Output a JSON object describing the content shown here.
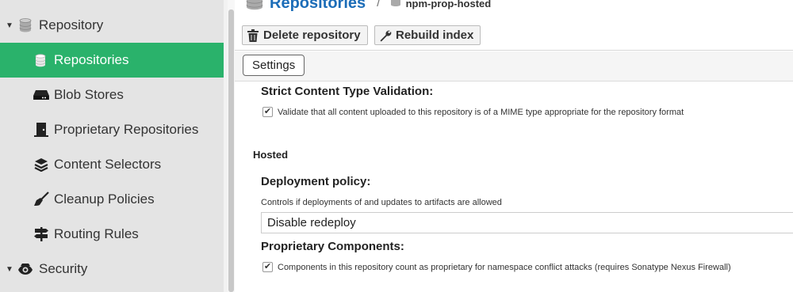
{
  "sidebar": {
    "repository_group": "Repository",
    "items": [
      {
        "label": "Repositories",
        "icon": "database-icon"
      },
      {
        "label": "Blob Stores",
        "icon": "hard-drive-icon"
      },
      {
        "label": "Proprietary Repositories",
        "icon": "door-icon"
      },
      {
        "label": "Content Selectors",
        "icon": "layers-icon"
      },
      {
        "label": "Cleanup Policies",
        "icon": "broom-icon"
      },
      {
        "label": "Routing Rules",
        "icon": "signpost-icon"
      }
    ],
    "security_group": "Security",
    "selected_color": "#2ab26b"
  },
  "header": {
    "title": "Repositories",
    "separator": "/",
    "current": "npm-prop-hosted"
  },
  "toolbar": {
    "delete_label": "Delete repository",
    "rebuild_label": "Rebuild index"
  },
  "tabs": {
    "settings_label": "Settings"
  },
  "form": {
    "strict_label": "Strict Content Type Validation:",
    "strict_text": "Validate that all content uploaded to this repository is of a MIME type appropriate for the repository format",
    "strict_checked": true,
    "hosted_section": "Hosted",
    "deploy_label": "Deployment policy:",
    "deploy_help": "Controls if deployments of and updates to artifacts are allowed",
    "deploy_value": "Disable redeploy",
    "prop_label": "Proprietary Components:",
    "prop_text": "Components in this repository count as proprietary for namespace conflict attacks (requires Sonatype Nexus Firewall)",
    "prop_checked": true
  }
}
